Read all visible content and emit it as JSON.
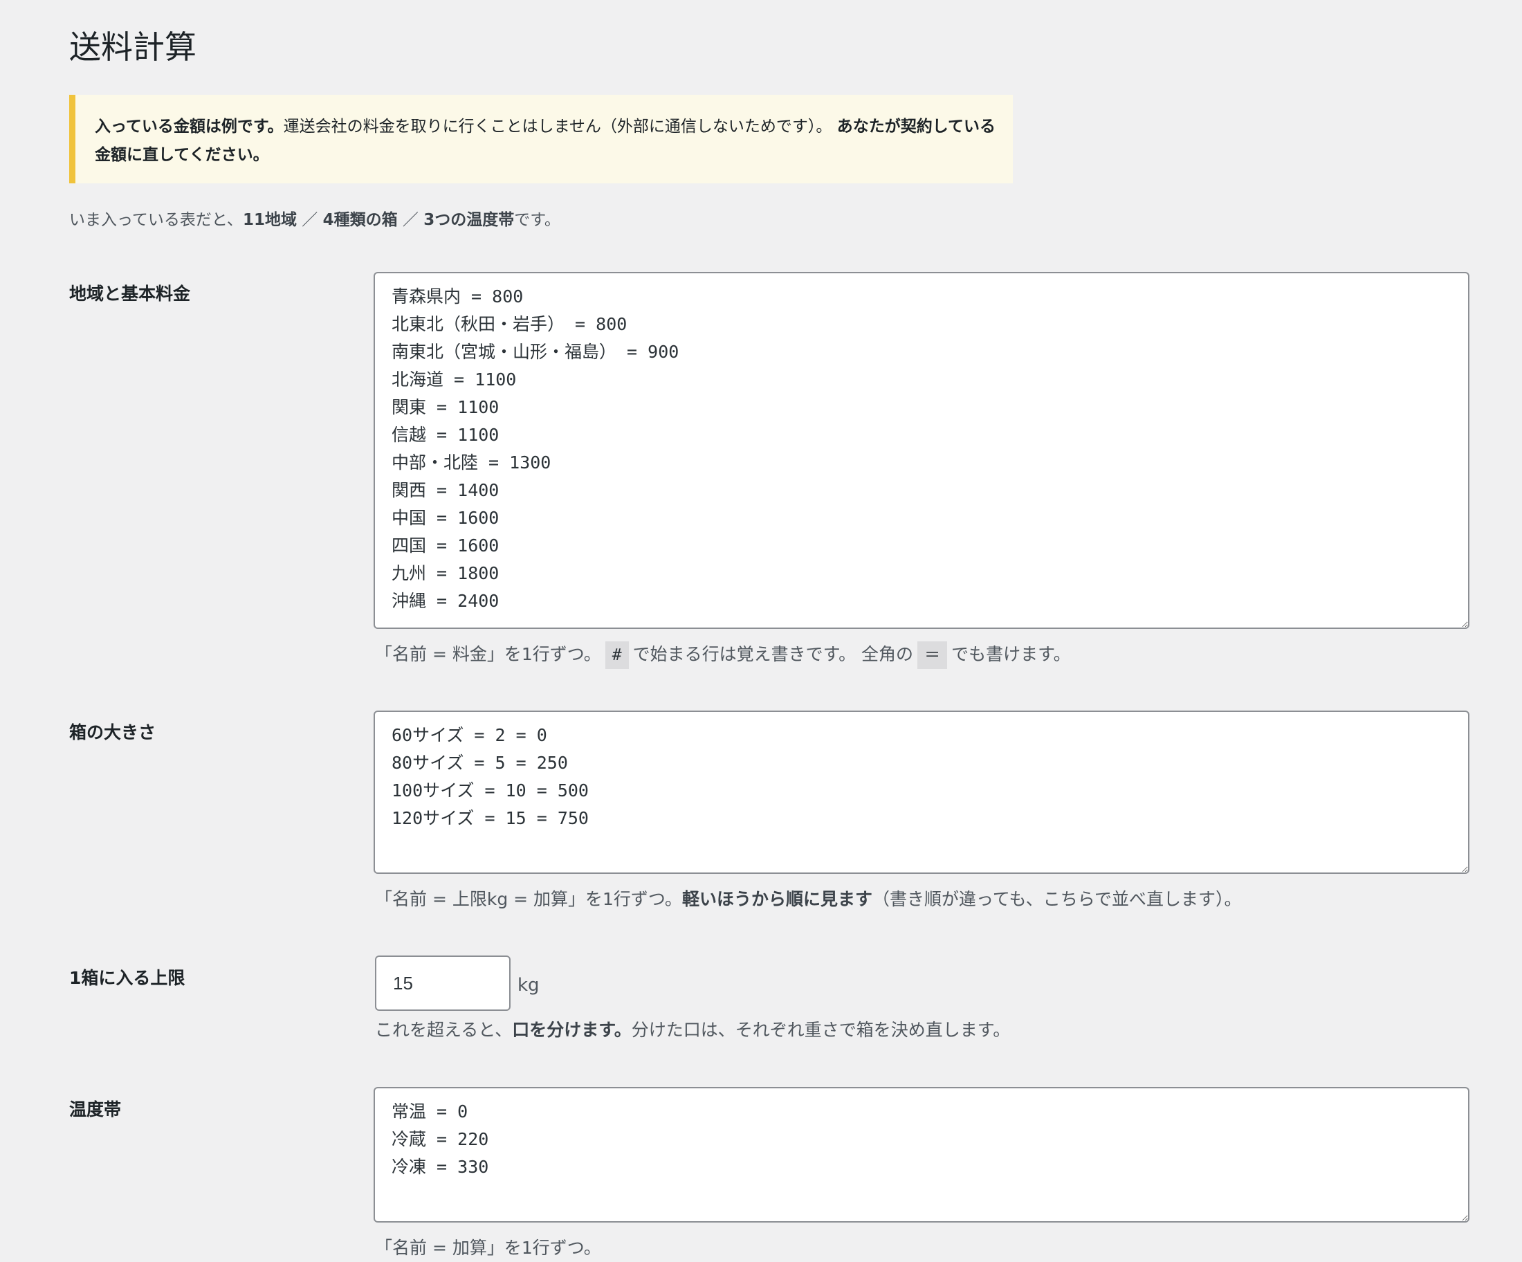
{
  "page": {
    "title": "送料計算"
  },
  "notice": {
    "bold_lead": "入っている金額は例です。",
    "text": "運送会社の料金を取りに行くことはしません（外部に通信しないためです）。",
    "bold_tail": "あなたが契約している金額に直してください。"
  },
  "summary": {
    "prefix": "いま入っている表だと、",
    "regions": "11地域",
    "sep1": " ／ ",
    "boxes": "4種類の箱",
    "sep2": " ／ ",
    "temps": "3つの温度帯",
    "suffix": "です。"
  },
  "regions": {
    "label": "地域と基本料金",
    "value": "青森県内 = 800\n北東北（秋田・岩手） = 800\n南東北（宮城・山形・福島） = 900\n北海道 = 1100\n関東 = 1100\n信越 = 1100\n中部・北陸 = 1300\n関西 = 1400\n中国 = 1600\n四国 = 1600\n九州 = 1800\n沖縄 = 2400",
    "help_part1": "「名前 = 料金」を1行ずつ。",
    "help_code1": "#",
    "help_part2": "で始まる行は覚え書きです。 全角の",
    "help_code2": "＝",
    "help_part3": "でも書けます。"
  },
  "boxes": {
    "label": "箱の大きさ",
    "value": "60サイズ = 2 = 0\n80サイズ = 5 = 250\n100サイズ = 10 = 500\n120サイズ = 15 = 750",
    "help_part1": "「名前 = 上限kg = 加算」を1行ずつ。",
    "help_bold": "軽いほうから順に見ます",
    "help_part2": "（書き順が違っても、こちらで並べ直します）。"
  },
  "max_weight": {
    "label": "1箱に入る上限",
    "value": "15",
    "unit": "kg",
    "help_part1": "これを超えると、",
    "help_bold": "口を分けます。",
    "help_part2": "分けた口は、それぞれ重さで箱を決め直します。"
  },
  "temperature": {
    "label": "温度帯",
    "value": "常温 = 0\n冷蔵 = 220\n冷凍 = 330",
    "help_partial": "「名前 = 加算」を1行ずつ。"
  }
}
